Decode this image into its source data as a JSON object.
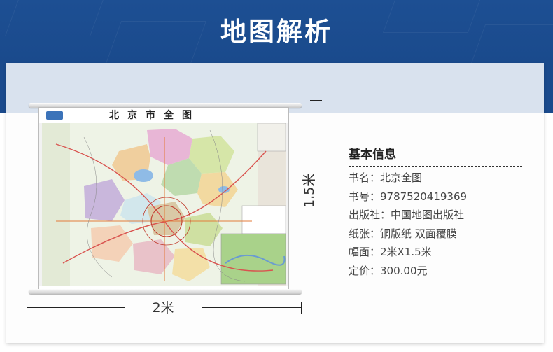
{
  "banner": {
    "title": "地图解析"
  },
  "map": {
    "title": "北京市全图",
    "dimensions": {
      "height_label": "1.5米",
      "width_label": "2米"
    }
  },
  "info": {
    "heading": "基本信息",
    "rows": [
      "书名：北京全图",
      "书号：9787520419369",
      "出版社：中国地图出版社",
      "纸张：铜版纸 双面覆膜",
      "幅面：2米X1.5米",
      "定价：300.00元"
    ]
  },
  "colors": {
    "banner_blue": "#1a4a8c",
    "card_tint": "#d9e2ee"
  }
}
